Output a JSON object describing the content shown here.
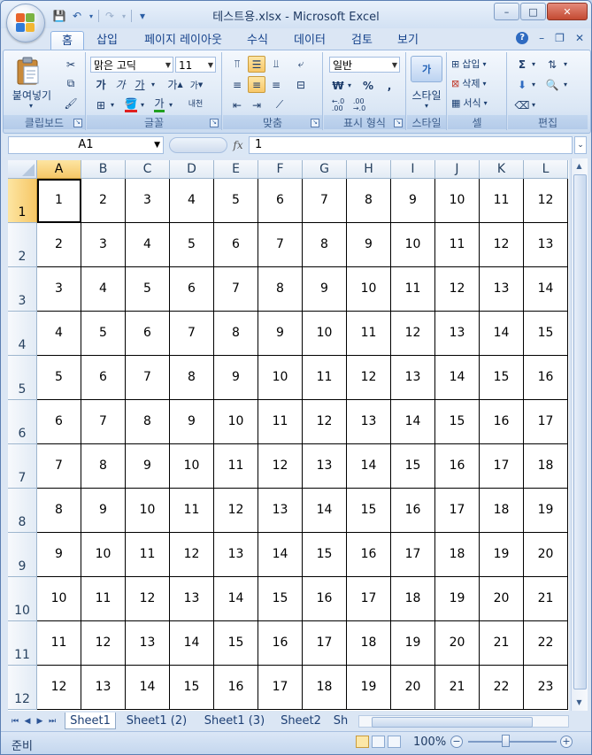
{
  "window": {
    "title": "테스트용.xlsx - Microsoft Excel",
    "minimize": "–",
    "maximize": "□",
    "close": "✕"
  },
  "qat": {
    "save_icon": "💾",
    "undo_icon": "↶",
    "redo_icon": "↷",
    "customize_icon": "▾"
  },
  "ribbon_tabs": [
    "홈",
    "삽입",
    "페이지 레이아웃",
    "수식",
    "데이터",
    "검토",
    "보기"
  ],
  "ribbon_right": {
    "help": "?",
    "min": "–",
    "restore": "❐",
    "close": "✕"
  },
  "ribbon": {
    "clipboard": {
      "label": "클립보드",
      "paste": "붙여넣기"
    },
    "font": {
      "label": "글꼴",
      "font_name": "맑은 고딕",
      "font_size": "11",
      "bold": "가",
      "italic": "가",
      "underline": "가",
      "grow": "가",
      "shrink": "가",
      "phonetic": "내천"
    },
    "alignment": {
      "label": "맞춤"
    },
    "number": {
      "label": "표시 형식",
      "format": "일반",
      "currency": "₩",
      "percent": "%",
      "comma": ","
    },
    "styles": {
      "label": "스타일",
      "button": "스타일"
    },
    "cells": {
      "label": "셀",
      "insert": "삽입",
      "delete": "삭제",
      "format": "서식"
    },
    "editing": {
      "label": "편집",
      "sum": "Σ"
    }
  },
  "formula_bar": {
    "name_box": "A1",
    "fx": "fx",
    "value": "1"
  },
  "grid": {
    "columns": [
      "A",
      "B",
      "C",
      "D",
      "E",
      "F",
      "G",
      "H",
      "I",
      "J",
      "K",
      "L"
    ],
    "rows": [
      "1",
      "2",
      "3",
      "4",
      "5",
      "6",
      "7",
      "8",
      "9",
      "10",
      "11",
      "12"
    ],
    "cells": [
      [
        "1",
        "2",
        "3",
        "4",
        "5",
        "6",
        "7",
        "8",
        "9",
        "10",
        "11",
        "12"
      ],
      [
        "2",
        "3",
        "4",
        "5",
        "6",
        "7",
        "8",
        "9",
        "10",
        "11",
        "12",
        "13"
      ],
      [
        "3",
        "4",
        "5",
        "6",
        "7",
        "8",
        "9",
        "10",
        "11",
        "12",
        "13",
        "14"
      ],
      [
        "4",
        "5",
        "6",
        "7",
        "8",
        "9",
        "10",
        "11",
        "12",
        "13",
        "14",
        "15"
      ],
      [
        "5",
        "6",
        "7",
        "8",
        "9",
        "10",
        "11",
        "12",
        "13",
        "14",
        "15",
        "16"
      ],
      [
        "6",
        "7",
        "8",
        "9",
        "10",
        "11",
        "12",
        "13",
        "14",
        "15",
        "16",
        "17"
      ],
      [
        "7",
        "8",
        "9",
        "10",
        "11",
        "12",
        "13",
        "14",
        "15",
        "16",
        "17",
        "18"
      ],
      [
        "8",
        "9",
        "10",
        "11",
        "12",
        "13",
        "14",
        "15",
        "16",
        "17",
        "18",
        "19"
      ],
      [
        "9",
        "10",
        "11",
        "12",
        "13",
        "14",
        "15",
        "16",
        "17",
        "18",
        "19",
        "20"
      ],
      [
        "10",
        "11",
        "12",
        "13",
        "14",
        "15",
        "16",
        "17",
        "18",
        "19",
        "20",
        "21"
      ],
      [
        "11",
        "12",
        "13",
        "14",
        "15",
        "16",
        "17",
        "18",
        "19",
        "20",
        "21",
        "22"
      ],
      [
        "12",
        "13",
        "14",
        "15",
        "16",
        "17",
        "18",
        "19",
        "20",
        "21",
        "22",
        "23"
      ]
    ],
    "active_cell": "A1"
  },
  "sheet_tabs": [
    "Sheet1",
    "Sheet1 (2)",
    "Sheet1 (3)",
    "Sheet2",
    "Sh"
  ],
  "status": {
    "ready": "준비",
    "zoom": "100%",
    "zoom_minus": "−",
    "zoom_plus": "+"
  }
}
